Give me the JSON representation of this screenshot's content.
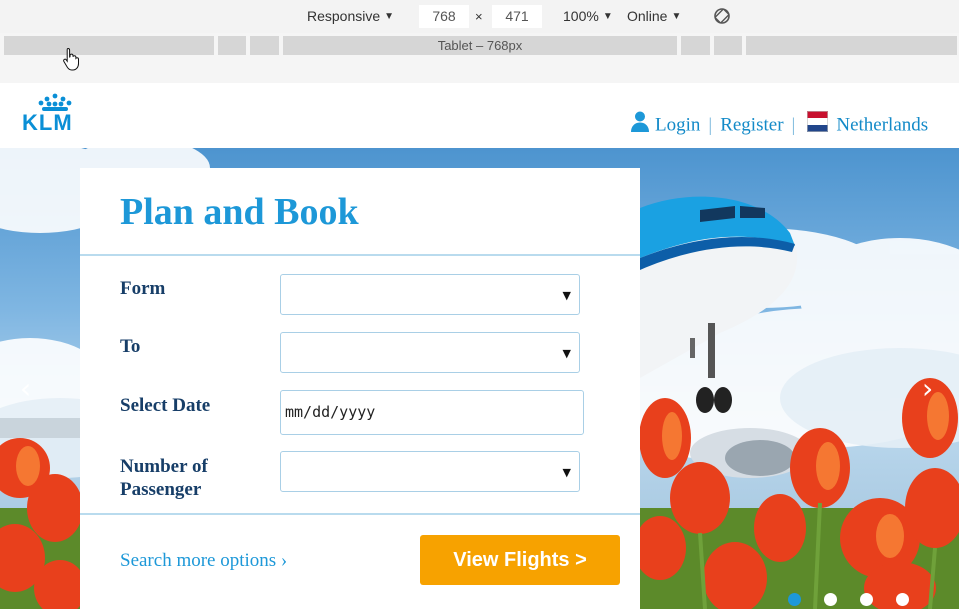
{
  "devtools": {
    "device": "Responsive",
    "width": "768",
    "times": "×",
    "height": "471",
    "zoom": "100%",
    "network": "Online",
    "caret": "▼",
    "breakpoint_label": "Tablet – 768px"
  },
  "header": {
    "logo_text": "KLM",
    "login": "Login",
    "register": "Register",
    "separator": "|",
    "country": "Netherlands"
  },
  "booking": {
    "title": "Plan and Book",
    "from_label": "Form",
    "to_label": "To",
    "date_label": "Select Date",
    "date_value": "mm/dd/yyyy",
    "passengers_label_line1": "Number of",
    "passengers_label_line2": "Passenger",
    "select_arrow": "▼",
    "more_options": "Search more options ›",
    "submit": "View Flights >"
  },
  "carousel": {
    "prev": "‹",
    "next": "›",
    "slides": 4,
    "active_slide": 1
  },
  "colors": {
    "brand_blue": "#1d98d8",
    "label_navy": "#173e68",
    "cta_orange": "#f7a200"
  }
}
